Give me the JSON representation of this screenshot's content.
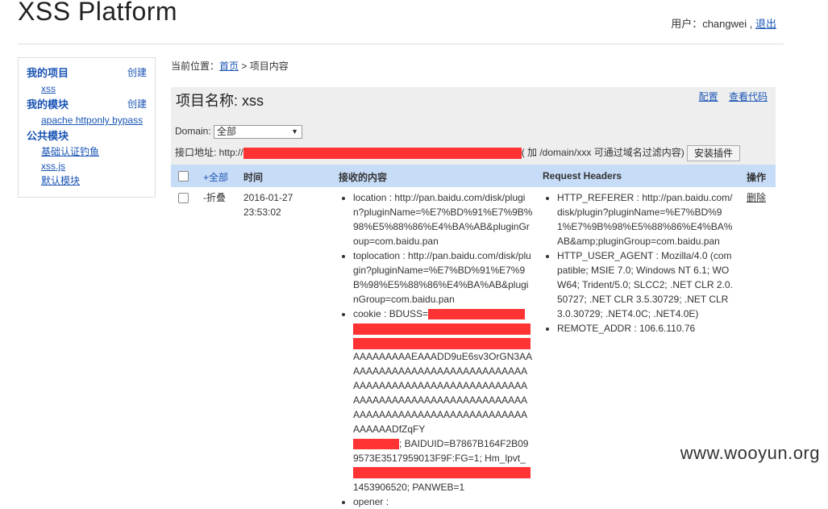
{
  "header": {
    "title": "XSS Platform",
    "user_label": "用户：changwei ,",
    "logout": "退出"
  },
  "sidebar": {
    "my_projects": "我的项目",
    "create1": "创建",
    "project_item": "xss",
    "my_modules": "我的模块",
    "create2": "创建",
    "module_item": "apache httponly bypass",
    "public_modules": "公共模块",
    "public_items": [
      "基础认证钓鱼",
      "xss.js",
      "默认模块"
    ]
  },
  "breadcrumb": {
    "prefix": "当前位置：",
    "home": "首页",
    "sep": "> 项目内容"
  },
  "project": {
    "title": "项目名称: xss",
    "config": "配置",
    "view_code": "查看代码",
    "domain_label": "Domain:",
    "domain_value": "全部",
    "api_label": "接口地址: http://",
    "api_note": "( 加 /domain/xxx 可通过域名过滤内容)",
    "install_btn": "安装插件"
  },
  "table": {
    "headers": {
      "all": "+全部",
      "time": "时间",
      "content": "接收的内容",
      "request_headers": "Request Headers",
      "action": "操作"
    },
    "row": {
      "toggle": "-折叠",
      "date": "2016-01-27",
      "time": "23:53:02",
      "location": "location : http://pan.baidu.com/disk/plugin?pluginName=%E7%BD%91%E7%9B%98%E5%88%86%E4%BA%AB&pluginGroup=com.baidu.pan",
      "toplocation": "toplocation : http://pan.baidu.com/disk/plugin?pluginName=%E7%BD%91%E7%9B%98%E5%88%86%E4%BA%AB&pluginGroup=com.baidu.pan",
      "cookie_start": "cookie : BDUSS=",
      "cookie_mid": "AAAAAAAAAEAAADD9uE6sv3OrGN3AAAAAAAAAAAAAAAAAAAAAAAAAAAAAAAAAAAAAAAAAAAAAAAAAAAAAAAAAAAAAAAAAAAAAAAAAAAAAAAAAAAAAAAAAAAAAAAAAAAAAAAAAAAAAAAAAAAADfZqFY",
      "cookie_tail": "; BAIDUID=B7867B164F2B099573E3517959013F9F:FG=1; Hm_lpvt_",
      "cookie_end": "1453906520; PANWEB=1",
      "opener": "opener :",
      "http_referer": "HTTP_REFERER : http://pan.baidu.com/disk/plugin?pluginName=%E7%BD%91%E7%9B%98%E5%88%86%E4%BA%AB&amp;pluginGroup=com.baidu.pan",
      "user_agent": "HTTP_USER_AGENT : Mozilla/4.0 (compatible; MSIE 7.0; Windows NT 6.1; WOW64; Trident/5.0; SLCC2; .NET CLR 2.0.50727; .NET CLR 3.5.30729; .NET CLR 3.0.30729; .NET4.0C; .NET4.0E)",
      "remote_addr": "REMOTE_ADDR : 106.6.110.76",
      "delete": "删除"
    }
  },
  "watermark": "www.wooyun.org",
  "colors": {
    "accent": "#1a55b4",
    "redaction": "#ff3333",
    "table_header": "#c7dcf7",
    "panel": "#eeeeee"
  }
}
